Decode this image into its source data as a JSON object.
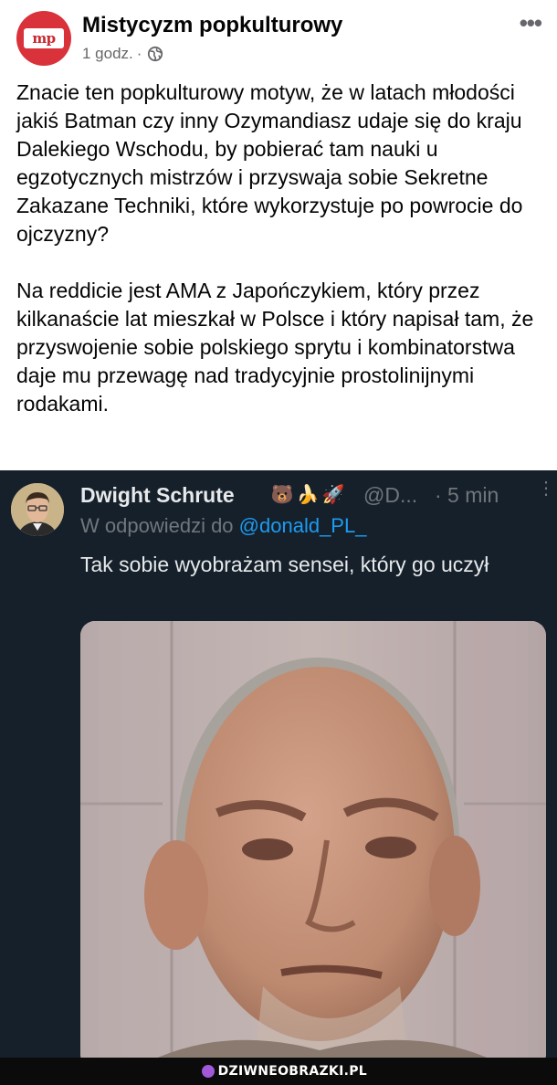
{
  "fb_post": {
    "page_name": "Mistycyzm popkulturowy",
    "logo_text": "mp",
    "time": "1 godz.",
    "separator": "·",
    "icons": {
      "audience": "globe-icon",
      "more": "more-horizontal-icon"
    },
    "more_label": "•••",
    "paragraphs": [
      "Znacie ten popkulturowy motyw, że w latach młodości jakiś Batman czy inny Ozymandiasz udaje się do kraju Dalekiego Wschodu, by pobierać tam nauki u egzotycznych mistrzów i przyswaja sobie Sekretne Zakazane Techniki, które wykorzystuje po powrocie do ojczyzny?",
      "Na reddicie jest AMA z Japończykiem, który przez kilkanaście lat mieszkał w Polsce i który napisał tam, że przyswojenie sobie polskiego sprytu i kombinatorstwa daje mu przewagę nad tradycyjnie prostolinijnymi rodakami."
    ]
  },
  "tweet": {
    "name": "Dwight Schrute",
    "emojis": [
      "🐻",
      "🍌",
      "🚀"
    ],
    "handle": "@D...",
    "time": "· 5 min",
    "more_label": "⋮",
    "reply_prefix": "W odpowiedzi do",
    "reply_to": "@donald_PL_",
    "text": "Tak sobie wyobrażam sensei, który go uczył",
    "icons": {
      "more": "more-vertical-icon"
    }
  },
  "watermark": {
    "text": "DZIWNEOBRAZKI.PL"
  },
  "colors": {
    "fb_background": "#ffffff",
    "tweet_background": "#15202b",
    "link_blue": "#1d9bf0",
    "page_avatar": "#d9323a"
  }
}
